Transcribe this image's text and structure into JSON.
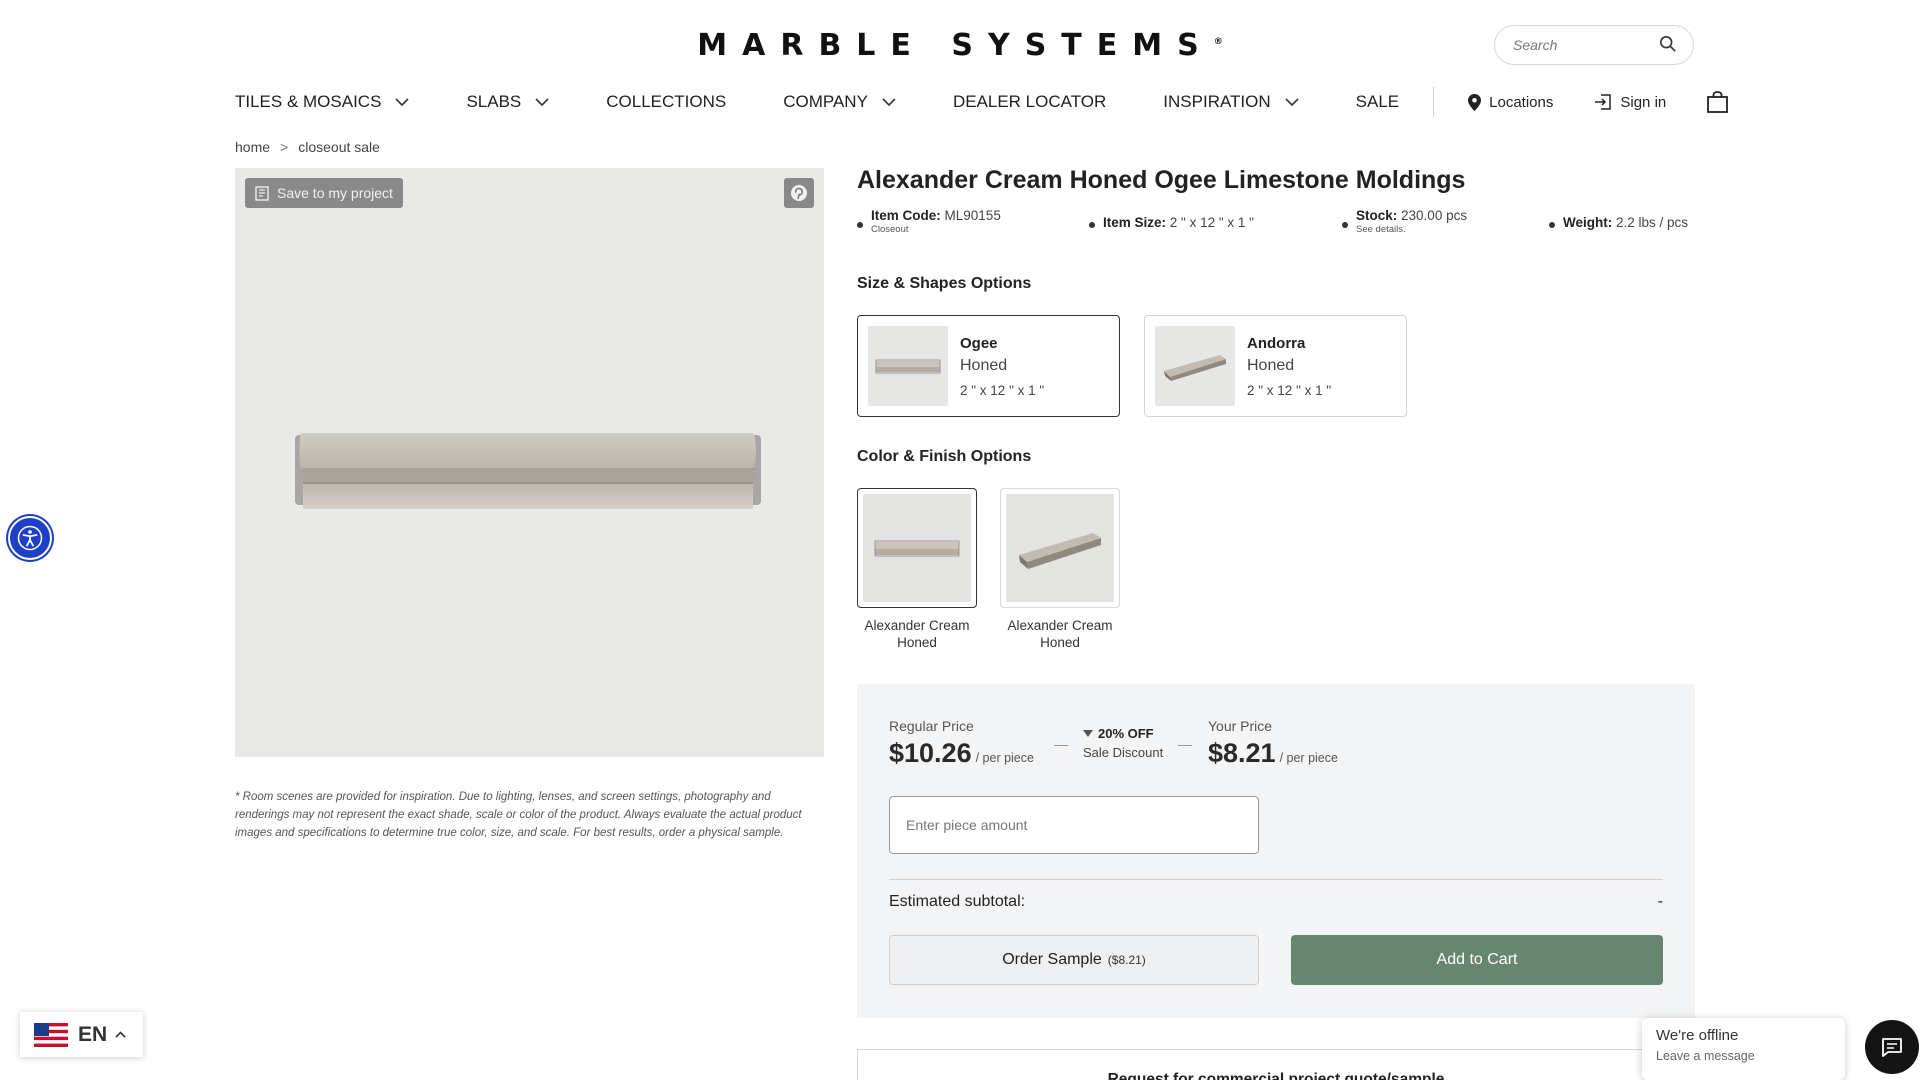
{
  "header": {
    "logo_text": "MARBLE SYSTEMS",
    "logo_mark": "®",
    "search_placeholder": "Search"
  },
  "nav": {
    "items": [
      {
        "label": "TILES & MOSAICS",
        "has_dropdown": true
      },
      {
        "label": "SLABS",
        "has_dropdown": true
      },
      {
        "label": "COLLECTIONS",
        "has_dropdown": false
      },
      {
        "label": "COMPANY",
        "has_dropdown": true
      },
      {
        "label": "DEALER LOCATOR",
        "has_dropdown": false
      },
      {
        "label": "INSPIRATION",
        "has_dropdown": true
      },
      {
        "label": "SALE",
        "has_dropdown": false
      }
    ],
    "locations_label": "Locations",
    "signin_label": "Sign in",
    "cart_icon": "shopping-bag-icon"
  },
  "breadcrumb": {
    "items": [
      "home",
      "closeout sale"
    ],
    "separator": ">"
  },
  "product": {
    "save_label": "Save to my project",
    "disclaimer": "* Room scenes are provided for inspiration. Due to lighting, lenses, and screen settings, photography and renderings may not represent the exact shade, scale or color of the product. Always evaluate the actual product images and specifications to determine true color, size, and scale. For best results, order a physical sample.",
    "title": "Alexander Cream Honed Ogee Limestone Moldings",
    "specs": {
      "item_code_label": "Item Code:",
      "item_code": "ML90155",
      "item_code_note": "Closeout",
      "size_label": "Item Size:",
      "size": "2 \" x 12 \" x 1 \"",
      "stock_label": "Stock:",
      "stock": "230.00 pcs",
      "stock_note": "See details.",
      "weight_label": "Weight:",
      "weight": "2.2 lbs / pcs"
    }
  },
  "shapes": {
    "heading": "Size & Shapes Options",
    "options": [
      {
        "name": "Ogee",
        "finish": "Honed",
        "size": "2 \" x 12 \" x 1 \"",
        "selected": true
      },
      {
        "name": "Andorra",
        "finish": "Honed",
        "size": "2 \" x 12 \" x 1 \"",
        "selected": false
      }
    ]
  },
  "colors": {
    "heading": "Color & Finish Options",
    "options": [
      {
        "label": "Alexander Cream Honed",
        "selected": true
      },
      {
        "label": "Alexander Cream Honed",
        "selected": false
      }
    ]
  },
  "pricing": {
    "regular_label": "Regular Price",
    "regular_price": "$10.26",
    "unit": "/ per piece",
    "discount": "20% OFF",
    "discount_label": "Sale Discount",
    "your_label": "Your Price",
    "your_price": "$8.21",
    "qty_placeholder": "Enter piece amount",
    "subtotal_label": "Estimated subtotal:",
    "subtotal_value": "-",
    "sample_label": "Order Sample",
    "sample_price": "($8.21)",
    "cart_label": "Add to Cart",
    "cart_color": "#68866f"
  },
  "quote": {
    "label": "Request for commercial project quote/sample"
  },
  "widgets": {
    "accessibility_icon": "accessibility-icon",
    "language_code": "EN",
    "language_flag": "us-flag-icon",
    "chat_title": "We're offline",
    "chat_subtitle": "Leave a message",
    "accessibility_color": "#1e40c8"
  }
}
